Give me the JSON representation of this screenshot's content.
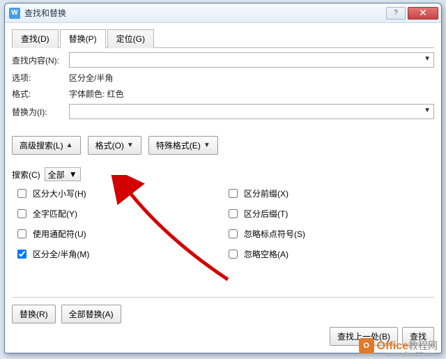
{
  "titlebar": {
    "icon": "W",
    "title": "查找和替换"
  },
  "tabs": [
    {
      "label": "查找(D)",
      "active": false
    },
    {
      "label": "替换(P)",
      "active": true
    },
    {
      "label": "定位(G)",
      "active": false
    }
  ],
  "form": {
    "find_label": "查找内容(N):",
    "options_label": "选项:",
    "options_value": "区分全/半角",
    "format_label": "格式:",
    "format_value": "字体颜色: 红色",
    "replace_label": "替换为(I):"
  },
  "buttons": {
    "advanced": "高级搜索(L)",
    "format": "格式(O)",
    "special": "特殊格式(E)"
  },
  "search_scope": {
    "label": "搜索(C)",
    "value": "全部"
  },
  "checks_left": [
    {
      "label": "区分大小写(H)",
      "checked": false
    },
    {
      "label": "全字匹配(Y)",
      "checked": false
    },
    {
      "label": "使用通配符(U)",
      "checked": false
    },
    {
      "label": "区分全/半角(M)",
      "checked": true
    }
  ],
  "checks_right": [
    {
      "label": "区分前缀(X)",
      "checked": false
    },
    {
      "label": "区分后缀(T)",
      "checked": false
    },
    {
      "label": "忽略标点符号(S)",
      "checked": false
    },
    {
      "label": "忽略空格(A)",
      "checked": false
    }
  ],
  "bottom": {
    "replace": "替换(R)",
    "replace_all": "全部替换(A)",
    "find_prev": "查找上一处(B)",
    "find_next": "查找"
  },
  "watermark": {
    "brand1": "Office",
    "brand2": "教程网",
    "url": "www.office26.com"
  }
}
